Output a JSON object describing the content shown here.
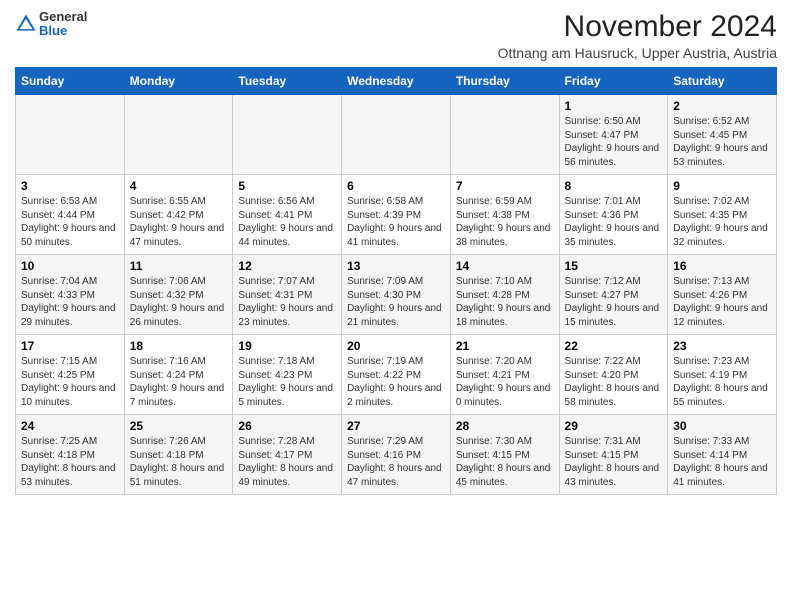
{
  "header": {
    "logo": {
      "general": "General",
      "blue": "Blue"
    },
    "title": "November 2024",
    "location": "Ottnang am Hausruck, Upper Austria, Austria"
  },
  "calendar": {
    "days_of_week": [
      "Sunday",
      "Monday",
      "Tuesday",
      "Wednesday",
      "Thursday",
      "Friday",
      "Saturday"
    ],
    "weeks": [
      [
        {
          "day": "",
          "info": ""
        },
        {
          "day": "",
          "info": ""
        },
        {
          "day": "",
          "info": ""
        },
        {
          "day": "",
          "info": ""
        },
        {
          "day": "",
          "info": ""
        },
        {
          "day": "1",
          "info": "Sunrise: 6:50 AM\nSunset: 4:47 PM\nDaylight: 9 hours and 56 minutes."
        },
        {
          "day": "2",
          "info": "Sunrise: 6:52 AM\nSunset: 4:45 PM\nDaylight: 9 hours and 53 minutes."
        }
      ],
      [
        {
          "day": "3",
          "info": "Sunrise: 6:53 AM\nSunset: 4:44 PM\nDaylight: 9 hours and 50 minutes."
        },
        {
          "day": "4",
          "info": "Sunrise: 6:55 AM\nSunset: 4:42 PM\nDaylight: 9 hours and 47 minutes."
        },
        {
          "day": "5",
          "info": "Sunrise: 6:56 AM\nSunset: 4:41 PM\nDaylight: 9 hours and 44 minutes."
        },
        {
          "day": "6",
          "info": "Sunrise: 6:58 AM\nSunset: 4:39 PM\nDaylight: 9 hours and 41 minutes."
        },
        {
          "day": "7",
          "info": "Sunrise: 6:59 AM\nSunset: 4:38 PM\nDaylight: 9 hours and 38 minutes."
        },
        {
          "day": "8",
          "info": "Sunrise: 7:01 AM\nSunset: 4:36 PM\nDaylight: 9 hours and 35 minutes."
        },
        {
          "day": "9",
          "info": "Sunrise: 7:02 AM\nSunset: 4:35 PM\nDaylight: 9 hours and 32 minutes."
        }
      ],
      [
        {
          "day": "10",
          "info": "Sunrise: 7:04 AM\nSunset: 4:33 PM\nDaylight: 9 hours and 29 minutes."
        },
        {
          "day": "11",
          "info": "Sunrise: 7:06 AM\nSunset: 4:32 PM\nDaylight: 9 hours and 26 minutes."
        },
        {
          "day": "12",
          "info": "Sunrise: 7:07 AM\nSunset: 4:31 PM\nDaylight: 9 hours and 23 minutes."
        },
        {
          "day": "13",
          "info": "Sunrise: 7:09 AM\nSunset: 4:30 PM\nDaylight: 9 hours and 21 minutes."
        },
        {
          "day": "14",
          "info": "Sunrise: 7:10 AM\nSunset: 4:28 PM\nDaylight: 9 hours and 18 minutes."
        },
        {
          "day": "15",
          "info": "Sunrise: 7:12 AM\nSunset: 4:27 PM\nDaylight: 9 hours and 15 minutes."
        },
        {
          "day": "16",
          "info": "Sunrise: 7:13 AM\nSunset: 4:26 PM\nDaylight: 9 hours and 12 minutes."
        }
      ],
      [
        {
          "day": "17",
          "info": "Sunrise: 7:15 AM\nSunset: 4:25 PM\nDaylight: 9 hours and 10 minutes."
        },
        {
          "day": "18",
          "info": "Sunrise: 7:16 AM\nSunset: 4:24 PM\nDaylight: 9 hours and 7 minutes."
        },
        {
          "day": "19",
          "info": "Sunrise: 7:18 AM\nSunset: 4:23 PM\nDaylight: 9 hours and 5 minutes."
        },
        {
          "day": "20",
          "info": "Sunrise: 7:19 AM\nSunset: 4:22 PM\nDaylight: 9 hours and 2 minutes."
        },
        {
          "day": "21",
          "info": "Sunrise: 7:20 AM\nSunset: 4:21 PM\nDaylight: 9 hours and 0 minutes."
        },
        {
          "day": "22",
          "info": "Sunrise: 7:22 AM\nSunset: 4:20 PM\nDaylight: 8 hours and 58 minutes."
        },
        {
          "day": "23",
          "info": "Sunrise: 7:23 AM\nSunset: 4:19 PM\nDaylight: 8 hours and 55 minutes."
        }
      ],
      [
        {
          "day": "24",
          "info": "Sunrise: 7:25 AM\nSunset: 4:18 PM\nDaylight: 8 hours and 53 minutes."
        },
        {
          "day": "25",
          "info": "Sunrise: 7:26 AM\nSunset: 4:18 PM\nDaylight: 8 hours and 51 minutes."
        },
        {
          "day": "26",
          "info": "Sunrise: 7:28 AM\nSunset: 4:17 PM\nDaylight: 8 hours and 49 minutes."
        },
        {
          "day": "27",
          "info": "Sunrise: 7:29 AM\nSunset: 4:16 PM\nDaylight: 8 hours and 47 minutes."
        },
        {
          "day": "28",
          "info": "Sunrise: 7:30 AM\nSunset: 4:15 PM\nDaylight: 8 hours and 45 minutes."
        },
        {
          "day": "29",
          "info": "Sunrise: 7:31 AM\nSunset: 4:15 PM\nDaylight: 8 hours and 43 minutes."
        },
        {
          "day": "30",
          "info": "Sunrise: 7:33 AM\nSunset: 4:14 PM\nDaylight: 8 hours and 41 minutes."
        }
      ]
    ]
  }
}
